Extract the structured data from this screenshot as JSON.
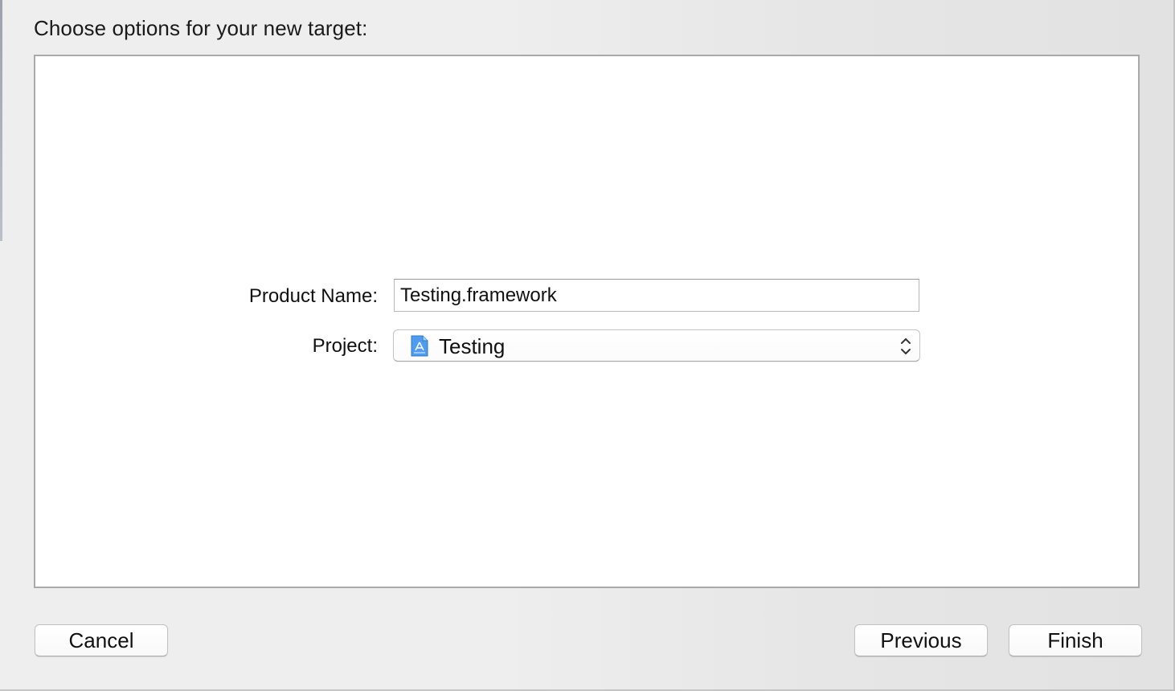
{
  "dialog": {
    "title": "Choose options for your new target:"
  },
  "form": {
    "product_name_label": "Product Name:",
    "product_name_value": "Testing.framework",
    "project_label": "Project:",
    "project_value": "Testing",
    "project_icon": "xcode-project-icon",
    "project_selector_icon": "up-down-chevron-icon"
  },
  "buttons": {
    "cancel": "Cancel",
    "previous": "Previous",
    "finish": "Finish"
  },
  "colors": {
    "sheet_background": "#eeeeee",
    "panel_background": "#ffffff",
    "project_icon_blue": "#3a8ee6"
  }
}
